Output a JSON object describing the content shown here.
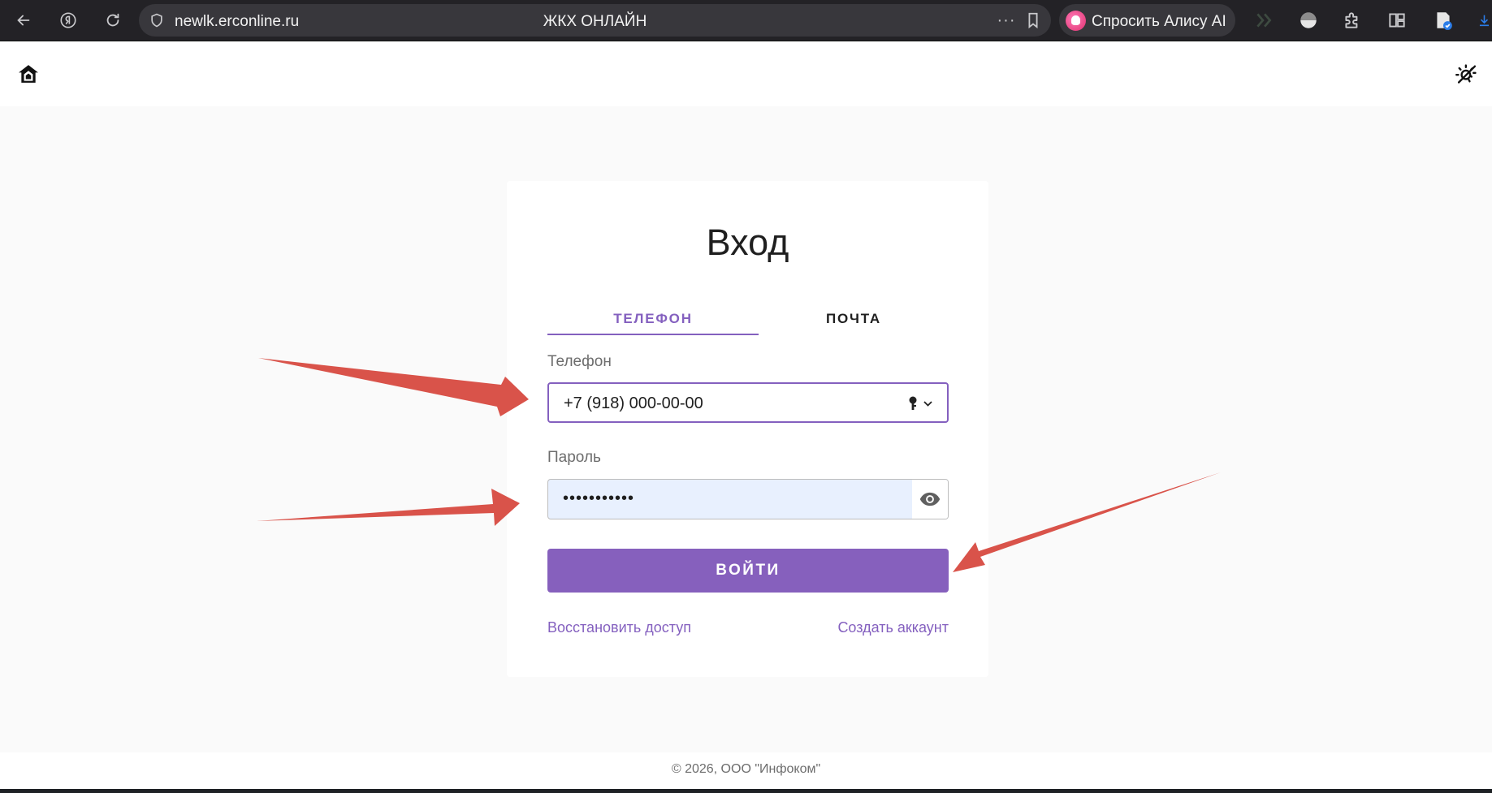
{
  "browser": {
    "url": "newlk.erconline.ru",
    "page_title": "ЖКХ ОНЛАЙН",
    "more_label": "···",
    "alice_label": "Спросить Алису AI"
  },
  "login": {
    "title": "Вход",
    "tabs": [
      {
        "label": "ТЕЛЕФОН",
        "active": true
      },
      {
        "label": "ПОЧТА",
        "active": false
      }
    ],
    "phone_label": "Телефон",
    "phone_value": "+7 (918) 000-00-00",
    "password_label": "Пароль",
    "password_value": "•••••••••••",
    "submit_label": "ВОЙТИ",
    "restore_link": "Восстановить доступ",
    "create_link": "Создать аккаунт"
  },
  "footer": {
    "copyright": "© 2026, ООО \"Инфоком\""
  },
  "colors": {
    "accent": "#8460bf",
    "annotation_arrow": "#d9534a",
    "autofill_bg": "#e8f0fe"
  },
  "icons": [
    "back-icon",
    "yandex-icon",
    "reload-icon",
    "shield-icon",
    "bookmark-icon",
    "alice-icon",
    "extension-icons",
    "home-icon",
    "theme-toggle-icon",
    "key-icon",
    "chevron-down-icon",
    "eye-icon"
  ]
}
